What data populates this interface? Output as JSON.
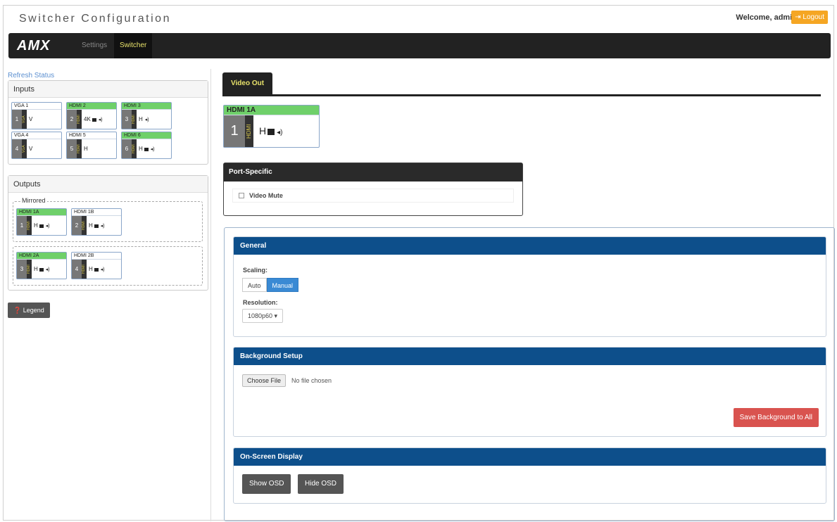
{
  "header": {
    "title": "Switcher Configuration",
    "welcome": "Welcome, admin",
    "logout_label": "Logout"
  },
  "navbar": {
    "logo": "AMX",
    "items": [
      {
        "label": "Settings"
      },
      {
        "label": "Switcher"
      }
    ]
  },
  "sidebar": {
    "refresh_label": "Refresh Status",
    "inputs_title": "Inputs",
    "inputs": [
      {
        "name": "VGA 1",
        "num": "1",
        "type": "VGA",
        "flags": "V",
        "active": false
      },
      {
        "name": "HDMI 2",
        "num": "2",
        "type": "HDMI",
        "flags": "4K",
        "active": true
      },
      {
        "name": "HDMI 3",
        "num": "3",
        "type": "HDMI",
        "flags": "H",
        "active": true
      },
      {
        "name": "VGA 4",
        "num": "4",
        "type": "VGA",
        "flags": "V",
        "active": false
      },
      {
        "name": "HDMI 5",
        "num": "5",
        "type": "HDMI",
        "flags": "H",
        "active": false
      },
      {
        "name": "HDMI 6",
        "num": "6",
        "type": "HDMI",
        "flags": "H",
        "active": true
      }
    ],
    "outputs_title": "Outputs",
    "mirrored_label": "Mirrored",
    "outputs": [
      {
        "name": "HDMI 1A",
        "num": "1",
        "type": "HDMI",
        "flags": "H",
        "active": true
      },
      {
        "name": "HDMI 1B",
        "num": "2",
        "type": "HDMI",
        "flags": "H",
        "active": false
      },
      {
        "name": "HDMI 2A",
        "num": "3",
        "type": "HDMI",
        "flags": "H",
        "active": true
      },
      {
        "name": "HDMI 2B",
        "num": "4",
        "type": "HDMI",
        "flags": "H",
        "active": false
      }
    ],
    "legend_label": "Legend"
  },
  "main": {
    "tab_label": "Video Out",
    "selected_output": {
      "name": "HDMI 1A",
      "num": "1",
      "type": "HDMI",
      "flags": "H"
    },
    "port_specific": {
      "title": "Port-Specific",
      "video_mute_label": "Video Mute"
    },
    "general": {
      "title": "General",
      "scaling_label": "Scaling:",
      "scaling_options": [
        "Auto",
        "Manual"
      ],
      "scaling_selected": "Manual",
      "resolution_label": "Resolution:",
      "resolution_value": "1080p60 ▾"
    },
    "background": {
      "title": "Background Setup",
      "choose_file_label": "Choose File",
      "file_status": "No file chosen",
      "save_label": "Save Background to All"
    },
    "osd": {
      "title": "On-Screen Display",
      "show_label": "Show OSD",
      "hide_label": "Hide OSD"
    }
  },
  "colors": {
    "active_tile": "#6fd06a",
    "section_header": "#0d4f8b",
    "save_button": "#d9534f",
    "manual_button": "#3a8ad4",
    "logout_button": "#f5a623"
  }
}
